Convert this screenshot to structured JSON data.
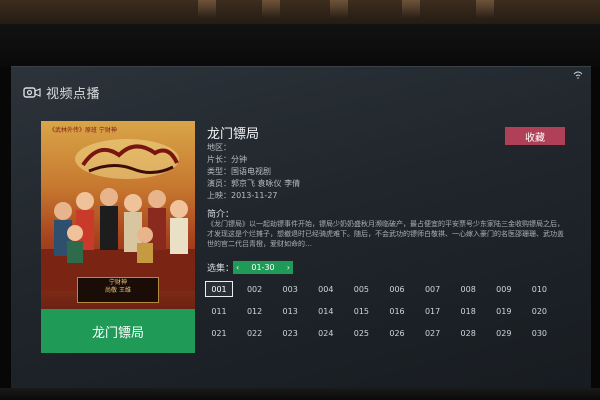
{
  "header": {
    "title": "视频点播",
    "logo_icon": "video-camera-icon"
  },
  "status": {
    "wifi_icon": "wifi-icon"
  },
  "poster": {
    "title": "龙门镖局",
    "tagline": "《武林外传》原班 宁财神",
    "plate_line1": "宁财神",
    "plate_line2": "尚敬 王维",
    "accent": "#1f9a57"
  },
  "detail": {
    "title": "龙门镖局",
    "favorite_label": "收藏",
    "meta": [
      {
        "key": "地区：",
        "value": ""
      },
      {
        "key": "片长：",
        "value": "分钟"
      },
      {
        "key": "类型：",
        "value": "国语电视剧"
      },
      {
        "key": "演员：",
        "value": "郭京飞 袁咏仪 李倩"
      },
      {
        "key": "上映：",
        "value": "2013-11-27"
      }
    ],
    "synopsis_heading": "简介：",
    "synopsis": "《龙门镖局》以一起劫镖事件开始，镖局少奶奶盛秋月濒临破产，最占便宜的平安票号少东家陆三金收购镖局之后，才发现这是个烂摊子，想撤退时已经骑虎难下。随后，不会武功的镖师白敬祺、一心嫁入豪门的名医邵珊珊、武功盖世的官二代吕青橙，爱财如命的…"
  },
  "episodes": {
    "label": "选集：",
    "range": "01-30",
    "selected": "001",
    "items": [
      "001",
      "002",
      "003",
      "004",
      "005",
      "006",
      "007",
      "008",
      "009",
      "010",
      "011",
      "012",
      "013",
      "014",
      "015",
      "016",
      "017",
      "018",
      "019",
      "020",
      "021",
      "022",
      "023",
      "024",
      "025",
      "026",
      "027",
      "028",
      "029",
      "030"
    ]
  },
  "colors": {
    "favorite": "#b04058",
    "green": "#1f9a57",
    "screen": "#252b31"
  }
}
